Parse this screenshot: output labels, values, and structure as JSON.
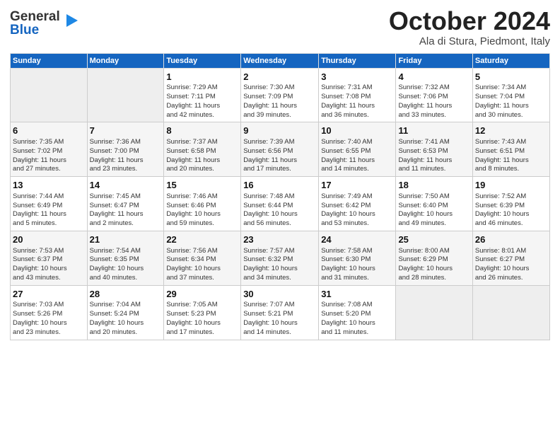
{
  "header": {
    "logo_line1": "General",
    "logo_line2": "Blue",
    "month": "October 2024",
    "location": "Ala di Stura, Piedmont, Italy"
  },
  "columns": [
    "Sunday",
    "Monday",
    "Tuesday",
    "Wednesday",
    "Thursday",
    "Friday",
    "Saturday"
  ],
  "weeks": [
    [
      {
        "day": "",
        "content": "",
        "empty": true
      },
      {
        "day": "",
        "content": "",
        "empty": true
      },
      {
        "day": "1",
        "content": "Sunrise: 7:29 AM\nSunset: 7:11 PM\nDaylight: 11 hours\nand 42 minutes."
      },
      {
        "day": "2",
        "content": "Sunrise: 7:30 AM\nSunset: 7:09 PM\nDaylight: 11 hours\nand 39 minutes."
      },
      {
        "day": "3",
        "content": "Sunrise: 7:31 AM\nSunset: 7:08 PM\nDaylight: 11 hours\nand 36 minutes."
      },
      {
        "day": "4",
        "content": "Sunrise: 7:32 AM\nSunset: 7:06 PM\nDaylight: 11 hours\nand 33 minutes."
      },
      {
        "day": "5",
        "content": "Sunrise: 7:34 AM\nSunset: 7:04 PM\nDaylight: 11 hours\nand 30 minutes."
      }
    ],
    [
      {
        "day": "6",
        "content": "Sunrise: 7:35 AM\nSunset: 7:02 PM\nDaylight: 11 hours\nand 27 minutes."
      },
      {
        "day": "7",
        "content": "Sunrise: 7:36 AM\nSunset: 7:00 PM\nDaylight: 11 hours\nand 23 minutes."
      },
      {
        "day": "8",
        "content": "Sunrise: 7:37 AM\nSunset: 6:58 PM\nDaylight: 11 hours\nand 20 minutes."
      },
      {
        "day": "9",
        "content": "Sunrise: 7:39 AM\nSunset: 6:56 PM\nDaylight: 11 hours\nand 17 minutes."
      },
      {
        "day": "10",
        "content": "Sunrise: 7:40 AM\nSunset: 6:55 PM\nDaylight: 11 hours\nand 14 minutes."
      },
      {
        "day": "11",
        "content": "Sunrise: 7:41 AM\nSunset: 6:53 PM\nDaylight: 11 hours\nand 11 minutes."
      },
      {
        "day": "12",
        "content": "Sunrise: 7:43 AM\nSunset: 6:51 PM\nDaylight: 11 hours\nand 8 minutes."
      }
    ],
    [
      {
        "day": "13",
        "content": "Sunrise: 7:44 AM\nSunset: 6:49 PM\nDaylight: 11 hours\nand 5 minutes."
      },
      {
        "day": "14",
        "content": "Sunrise: 7:45 AM\nSunset: 6:47 PM\nDaylight: 11 hours\nand 2 minutes."
      },
      {
        "day": "15",
        "content": "Sunrise: 7:46 AM\nSunset: 6:46 PM\nDaylight: 10 hours\nand 59 minutes."
      },
      {
        "day": "16",
        "content": "Sunrise: 7:48 AM\nSunset: 6:44 PM\nDaylight: 10 hours\nand 56 minutes."
      },
      {
        "day": "17",
        "content": "Sunrise: 7:49 AM\nSunset: 6:42 PM\nDaylight: 10 hours\nand 53 minutes."
      },
      {
        "day": "18",
        "content": "Sunrise: 7:50 AM\nSunset: 6:40 PM\nDaylight: 10 hours\nand 49 minutes."
      },
      {
        "day": "19",
        "content": "Sunrise: 7:52 AM\nSunset: 6:39 PM\nDaylight: 10 hours\nand 46 minutes."
      }
    ],
    [
      {
        "day": "20",
        "content": "Sunrise: 7:53 AM\nSunset: 6:37 PM\nDaylight: 10 hours\nand 43 minutes."
      },
      {
        "day": "21",
        "content": "Sunrise: 7:54 AM\nSunset: 6:35 PM\nDaylight: 10 hours\nand 40 minutes."
      },
      {
        "day": "22",
        "content": "Sunrise: 7:56 AM\nSunset: 6:34 PM\nDaylight: 10 hours\nand 37 minutes."
      },
      {
        "day": "23",
        "content": "Sunrise: 7:57 AM\nSunset: 6:32 PM\nDaylight: 10 hours\nand 34 minutes."
      },
      {
        "day": "24",
        "content": "Sunrise: 7:58 AM\nSunset: 6:30 PM\nDaylight: 10 hours\nand 31 minutes."
      },
      {
        "day": "25",
        "content": "Sunrise: 8:00 AM\nSunset: 6:29 PM\nDaylight: 10 hours\nand 28 minutes."
      },
      {
        "day": "26",
        "content": "Sunrise: 8:01 AM\nSunset: 6:27 PM\nDaylight: 10 hours\nand 26 minutes."
      }
    ],
    [
      {
        "day": "27",
        "content": "Sunrise: 7:03 AM\nSunset: 5:26 PM\nDaylight: 10 hours\nand 23 minutes."
      },
      {
        "day": "28",
        "content": "Sunrise: 7:04 AM\nSunset: 5:24 PM\nDaylight: 10 hours\nand 20 minutes."
      },
      {
        "day": "29",
        "content": "Sunrise: 7:05 AM\nSunset: 5:23 PM\nDaylight: 10 hours\nand 17 minutes."
      },
      {
        "day": "30",
        "content": "Sunrise: 7:07 AM\nSunset: 5:21 PM\nDaylight: 10 hours\nand 14 minutes."
      },
      {
        "day": "31",
        "content": "Sunrise: 7:08 AM\nSunset: 5:20 PM\nDaylight: 10 hours\nand 11 minutes."
      },
      {
        "day": "",
        "content": "",
        "empty": true
      },
      {
        "day": "",
        "content": "",
        "empty": true
      }
    ]
  ]
}
